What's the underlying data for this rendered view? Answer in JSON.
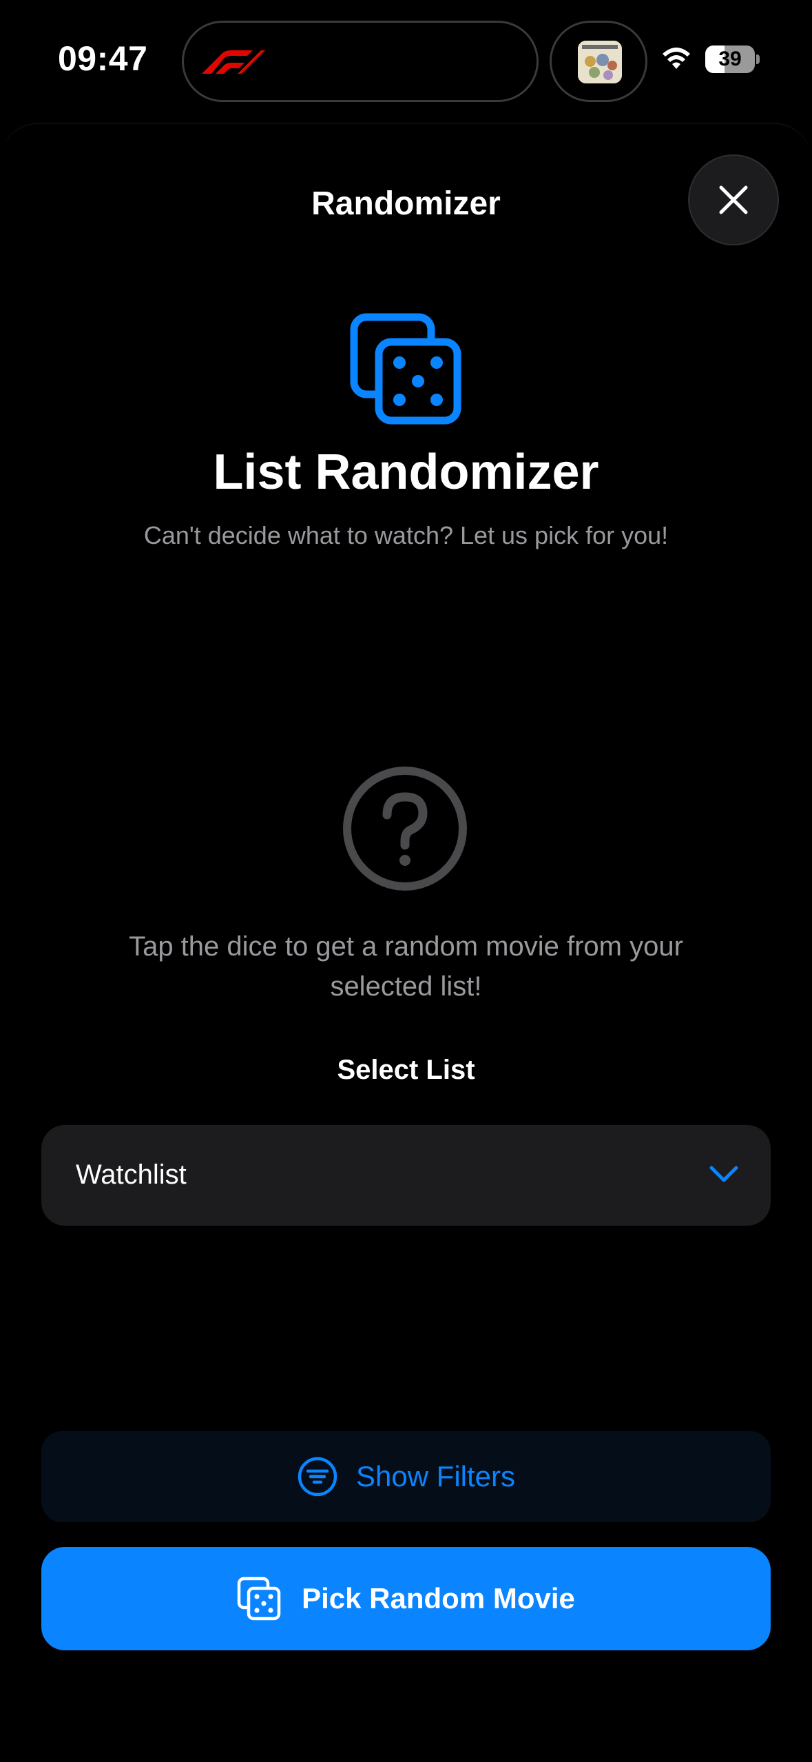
{
  "status_bar": {
    "time": "09:47",
    "battery_level": "39",
    "battery_fraction": 0.39
  },
  "sheet": {
    "title": "Randomizer"
  },
  "hero": {
    "title": "List Randomizer",
    "subtitle": "Can't decide what to watch? Let us pick for you!"
  },
  "empty_state": {
    "message": "Tap the dice to get a random movie from your selected list!"
  },
  "list_select": {
    "label": "Select List",
    "selected": "Watchlist"
  },
  "actions": {
    "filters_label": "Show Filters",
    "pick_label": "Pick Random Movie"
  },
  "colors": {
    "accent": "#0a84ff",
    "background": "#000000",
    "card": "#1c1c1e",
    "secondary_text": "#9a9a9e"
  },
  "icons": {
    "f1": "f1-logo",
    "thumb": "app-thumbnail",
    "wifi": "wifi-icon",
    "close": "close-icon",
    "dice": "dice-icon",
    "question": "question-circle-icon",
    "chevron": "chevron-down-icon",
    "filter": "filter-icon"
  }
}
